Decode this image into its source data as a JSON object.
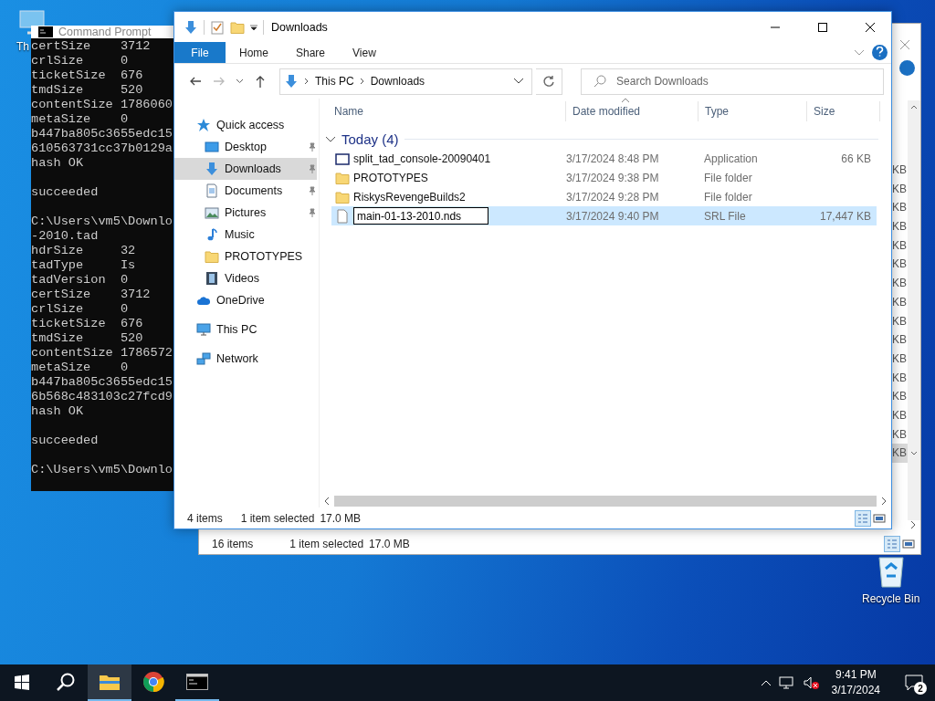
{
  "desktop": {
    "icons": [
      {
        "label": "Th",
        "kind": "pc"
      },
      {
        "label": "Recycle Bin",
        "kind": "recycle"
      }
    ]
  },
  "back_explorer": {
    "rows": [
      {
        "size": "KB",
        "selected": false
      },
      {
        "size": "KB",
        "selected": false
      },
      {
        "size": "KB",
        "selected": false
      },
      {
        "size": "KB",
        "selected": false
      },
      {
        "size": "KB",
        "selected": false
      },
      {
        "size": "KB",
        "selected": false
      },
      {
        "size": "KB",
        "selected": false
      },
      {
        "size": "KB",
        "selected": false
      },
      {
        "size": "KB",
        "selected": false
      },
      {
        "size": "KB",
        "selected": false
      },
      {
        "size": "KB",
        "selected": false
      },
      {
        "size": "KB",
        "selected": false
      },
      {
        "size": "KB",
        "selected": false
      },
      {
        "size": "KB",
        "selected": false
      },
      {
        "size": "KB",
        "selected": false
      },
      {
        "size": "KB",
        "selected": true
      }
    ],
    "status_bar": {
      "items": "16 items",
      "selection": "1 item selected",
      "selection_size": "17.0 MB"
    },
    "views": [
      {
        "kind": "details",
        "selected": true
      },
      {
        "kind": "tiles",
        "selected": false
      }
    ]
  },
  "command_prompt": {
    "title": "Command Prompt",
    "blocks": [
      [
        "certSize    3712",
        "crlSize     0",
        "ticketSize  676",
        "tmdSize     520",
        "contentSize 1786060",
        "metaSize    0",
        "b447ba805c3655edc15",
        "610563731cc37b0129a",
        "hash OK"
      ],
      [
        "succeeded"
      ],
      [
        "C:\\Users\\vm5\\Downlo",
        "-2010.tad",
        "hdrSize     32",
        "tadType     Is",
        "tadVersion  0",
        "certSize    3712",
        "crlSize     0",
        "ticketSize  676",
        "tmdSize     520",
        "contentSize 1786572",
        "metaSize    0",
        "b447ba805c3655edc15",
        "6b568c483103c27fcd9",
        "hash OK"
      ],
      [
        "succeeded"
      ],
      [
        "C:\\Users\\vm5\\Downlo"
      ]
    ]
  },
  "explorer": {
    "title": "Downloads",
    "ribbon_tabs": [
      {
        "label": "File",
        "selected": true
      },
      {
        "label": "Home",
        "selected": false
      },
      {
        "label": "Share",
        "selected": false
      },
      {
        "label": "View",
        "selected": false
      }
    ],
    "address": {
      "path": [
        "This PC",
        "Downloads"
      ]
    },
    "search": {
      "placeholder": "Search Downloads"
    },
    "nav": [
      {
        "label": "Quick access",
        "kind": "star",
        "selected": false,
        "children": [
          {
            "label": "Desktop",
            "kind": "desktop",
            "pinned": true,
            "selected": false
          },
          {
            "label": "Downloads",
            "kind": "download",
            "pinned": true,
            "selected": true
          },
          {
            "label": "Documents",
            "kind": "document",
            "pinned": true,
            "selected": false
          },
          {
            "label": "Pictures",
            "kind": "pictures",
            "pinned": true,
            "selected": false
          },
          {
            "label": "Music",
            "kind": "music",
            "pinned": false,
            "selected": false
          },
          {
            "label": "PROTOTYPES",
            "kind": "folder",
            "pinned": false,
            "selected": false
          },
          {
            "label": "Videos",
            "kind": "videos",
            "pinned": false,
            "selected": false
          }
        ]
      },
      {
        "label": "OneDrive",
        "kind": "cloud",
        "selected": false
      },
      {
        "label": "This PC",
        "kind": "pc",
        "selected": false
      },
      {
        "label": "Network",
        "kind": "network",
        "selected": false
      }
    ],
    "columns": [
      {
        "label": "Name",
        "sorted": false
      },
      {
        "label": "Date modified",
        "sorted": true
      },
      {
        "label": "Type",
        "sorted": false
      },
      {
        "label": "Size",
        "sorted": false
      }
    ],
    "group": {
      "label": "Today (4)",
      "expanded": true
    },
    "files": [
      {
        "name": "split_tad_console-20090401",
        "date": "3/17/2024 8:48 PM",
        "type": "Application",
        "size": "66 KB",
        "kind": "app",
        "selected": false,
        "renaming": false
      },
      {
        "name": "PROTOTYPES",
        "date": "3/17/2024 9:38 PM",
        "type": "File folder",
        "kind": "folder",
        "selected": false,
        "renaming": false
      },
      {
        "name": "RiskysRevengeBuilds2",
        "date": "3/17/2024 9:28 PM",
        "type": "File folder",
        "kind": "folder",
        "selected": false,
        "renaming": false
      },
      {
        "name": "main-01-13-2010.nds",
        "date": "3/17/2024 9:40 PM",
        "type": "SRL File",
        "size": "17,447 KB",
        "kind": "file",
        "selected": true,
        "renaming": true
      }
    ],
    "status_bar": {
      "items": "4 items",
      "selection": "1 item selected",
      "selection_size": "17.0 MB"
    },
    "views": [
      {
        "kind": "details",
        "selected": true
      },
      {
        "kind": "tiles",
        "selected": false
      }
    ]
  },
  "taskbar": {
    "apps": [
      {
        "kind": "start",
        "active": false,
        "running": false
      },
      {
        "kind": "search",
        "active": false,
        "running": false
      },
      {
        "kind": "explorer",
        "active": true,
        "running": true
      },
      {
        "kind": "chrome",
        "active": false,
        "running": false
      },
      {
        "kind": "terminal",
        "active": false,
        "running": true
      }
    ],
    "time": "9:41 PM",
    "date": "3/17/2024",
    "notifications": "2"
  }
}
